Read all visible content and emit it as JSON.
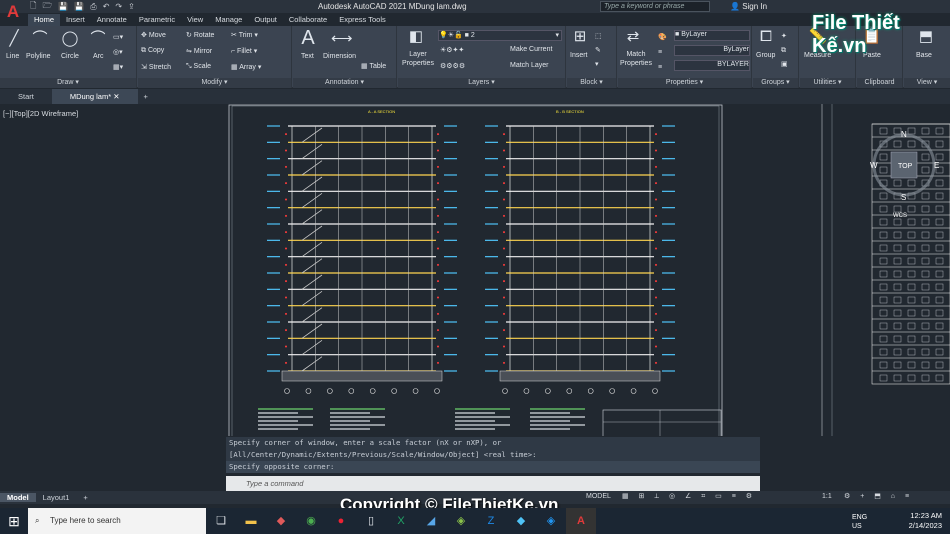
{
  "app": {
    "title": "Autodesk AutoCAD 2021    MDung lam.dwg",
    "logo": "A"
  },
  "quick_access": [
    "🗋",
    "🗁",
    "💾",
    "💾",
    "⎙",
    "↶",
    "↷",
    "⇪"
  ],
  "search": {
    "placeholder": "Type a keyword or phrase"
  },
  "user": {
    "signin": "Sign In"
  },
  "ribbon_tabs": [
    "Home",
    "Insert",
    "Annotate",
    "Parametric",
    "View",
    "Manage",
    "Output",
    "Collaborate",
    "Express Tools"
  ],
  "panels": {
    "draw": {
      "label": "Draw ▾",
      "tools": [
        "Line",
        "Polyline",
        "Circle",
        "Arc"
      ]
    },
    "modify": {
      "label": "Modify ▾",
      "tools": [
        "Move",
        "Rotate",
        "Trim",
        "Copy",
        "Mirror",
        "Fillet",
        "Stretch",
        "Scale",
        "Array"
      ]
    },
    "annotation": {
      "label": "Annotation ▾",
      "tools": [
        "Text",
        "Dimension",
        "Table"
      ]
    },
    "layers": {
      "label": "Layers ▾",
      "layer_props": "Layer Properties",
      "current_layer": "2",
      "make_current": "Make Current",
      "match_layer": "Match Layer"
    },
    "block": {
      "label": "Block ▾",
      "insert": "Insert"
    },
    "properties": {
      "label": "Properties ▾",
      "match": "Match Properties",
      "color": "ByLayer",
      "linetype": "ByLayer",
      "lineweight": "BYLAYER"
    },
    "groups": {
      "label": "Groups ▾",
      "group": "Group"
    },
    "utilities": {
      "label": "Utilities ▾",
      "measure": "Measure"
    },
    "clipboard": {
      "label": "Clipboard",
      "paste": "Paste"
    },
    "view": {
      "label": "View ▾",
      "base": "Base"
    }
  },
  "watermark": "File Thiết Kế.vn",
  "doc_tabs": [
    "Start",
    "MDung lam*"
  ],
  "viewport": {
    "label": "[−][Top][2D Wireframe]",
    "section_a": "A - A SECTION",
    "section_b": "B - B SECTION",
    "viewcube_top": "TOP",
    "compass": [
      "N",
      "W",
      "E",
      "S"
    ],
    "wcs": "WCS"
  },
  "command_history": [
    "Specify corner of window, enter a scale factor (nX or nXP), or",
    "[All/Center/Dynamic/Extents/Previous/Scale/Window/Object] <real time>:",
    "Specify opposite corner:"
  ],
  "command_input": {
    "placeholder": "Type a command"
  },
  "layout_tabs": [
    "Model",
    "Layout1",
    "+"
  ],
  "status": {
    "model": "MODEL",
    "scale": "1:1"
  },
  "copyright": "Copyright © FileThietKe.vn",
  "taskbar": {
    "search_placeholder": "Type here to search",
    "lang": "ENG",
    "region": "US",
    "time": "12:23 AM",
    "date": "2/14/2023"
  },
  "colors": {
    "accent": "#e03a3a",
    "ribbon": "#3b4451",
    "canvas": "#212830"
  }
}
